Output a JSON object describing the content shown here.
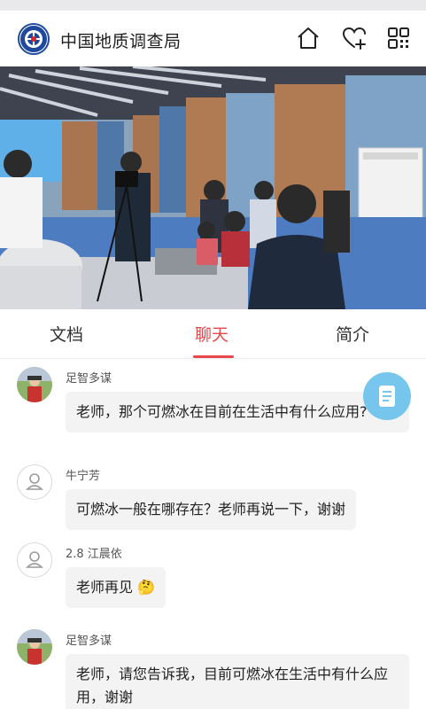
{
  "header": {
    "title": "中国地质调查局",
    "icons": [
      "home-icon",
      "heart-plus-icon",
      "qr-code-icon"
    ]
  },
  "tabs": [
    {
      "label": "文档",
      "active": false
    },
    {
      "label": "聊天",
      "active": true
    },
    {
      "label": "简介",
      "active": false
    }
  ],
  "colors": {
    "accent": "#e8474b",
    "floating_button": "#6cc2ec",
    "bubble_bg": "#f3f3f3"
  },
  "messages": [
    {
      "sender": "足智多谋",
      "text": "老师，那个可燃冰在目前在生活中有什么应用?",
      "avatar": "photo"
    },
    {
      "sender": "牛宁芳",
      "text": "可燃冰一般在哪存在？老师再说一下，谢谢",
      "avatar": "default-user-icon"
    },
    {
      "sender": "2.8 江晨依",
      "text": "老师再见",
      "emoji": "🤔",
      "avatar": "default-user-icon"
    },
    {
      "sender": "足智多谋",
      "text": "老师，请您告诉我，目前可燃冰在生活中有什么应用，谢谢",
      "avatar": "photo"
    }
  ]
}
